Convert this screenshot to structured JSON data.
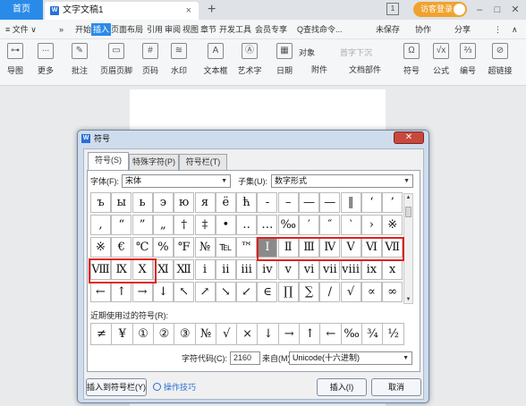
{
  "tabbar": {
    "home": "首页",
    "doc_title": "文字文稿1",
    "doc_icon": "W",
    "close": "×",
    "new_tab": "+",
    "badge": "1",
    "login": "访客登录",
    "minimize": "–",
    "restore": "□",
    "close_window": "✕"
  },
  "menubar": {
    "file": "≡ 文件 ∨",
    "more": "»",
    "items": [
      "开始",
      "插入",
      "页面布局",
      "引用",
      "审阅",
      "视图",
      "章节",
      "开发工具",
      "会员专享"
    ],
    "search": "Q查找命令...",
    "unsaved": "未保存",
    "collab": "协作",
    "share": "分享",
    "more_menu": "⋮",
    "collapse": "∧"
  },
  "ribbon": {
    "buttons": [
      "导图",
      "更多",
      "批注",
      "页眉页脚",
      "页码",
      "水印",
      "文本框",
      "艺术字",
      "日期",
      "符号",
      "公式",
      "编号",
      "超链接"
    ],
    "small": [
      "对象",
      "首字下沉",
      "附件",
      "文档部件"
    ]
  },
  "dialog": {
    "title": "符号",
    "close": "✕",
    "tabs": [
      "符号(S)",
      "特殊字符(P)",
      "符号栏(T)"
    ],
    "font_label": "字体(F):",
    "font_value": "宋体",
    "subset_label": "子集(U):",
    "subset_value": "数字形式",
    "symbols": [
      [
        "ъ",
        "ы",
        "ь",
        "э",
        "ю",
        "я",
        "ё",
        "ћ",
        "-",
        "–",
        "—",
        "—",
        "‖",
        "‘",
        "’"
      ],
      [
        "‚",
        "“",
        "”",
        "„",
        "†",
        "‡",
        "•",
        "‥",
        "…",
        "‰",
        "′",
        "″",
        "‵",
        "›",
        "※"
      ],
      [
        "※",
        "€",
        "℃",
        "%",
        "℉",
        "№",
        "℡",
        "™",
        "Ⅰ",
        "Ⅱ",
        "Ⅲ",
        "Ⅳ",
        "Ⅴ",
        "Ⅵ",
        "Ⅶ"
      ],
      [
        "Ⅷ",
        "Ⅸ",
        "Ⅹ",
        "Ⅺ",
        "Ⅻ",
        "ⅰ",
        "ⅱ",
        "ⅲ",
        "ⅳ",
        "ⅴ",
        "ⅵ",
        "ⅶ",
        "ⅷ",
        "ⅸ",
        "ⅹ"
      ],
      [
        "←",
        "↑",
        "→",
        "↓",
        "↖",
        "↗",
        "↘",
        "↙",
        "∈",
        "∏",
        "∑",
        "∕",
        "√",
        "∝",
        "∞"
      ]
    ],
    "selected": "Ⅰ",
    "recent_label": "近期使用过的符号(R):",
    "recent": [
      "≠",
      "¥",
      "①",
      "②",
      "③",
      "№",
      "√",
      "×",
      "↓",
      "→",
      "↑",
      "←",
      "‰",
      "¾",
      "½"
    ],
    "code_label": "字符代码(C):",
    "code_value": "2160",
    "from_label": "来自(M)",
    "from_value": "Unicode(十六进制)",
    "insert_bar": "插入到符号栏(Y)",
    "tips": "操作技巧",
    "insert": "插入(I)",
    "cancel": "取消"
  },
  "colors": {
    "accent": "#2a8ae8",
    "highlight": "#e02020",
    "login": "#f0a22e"
  }
}
